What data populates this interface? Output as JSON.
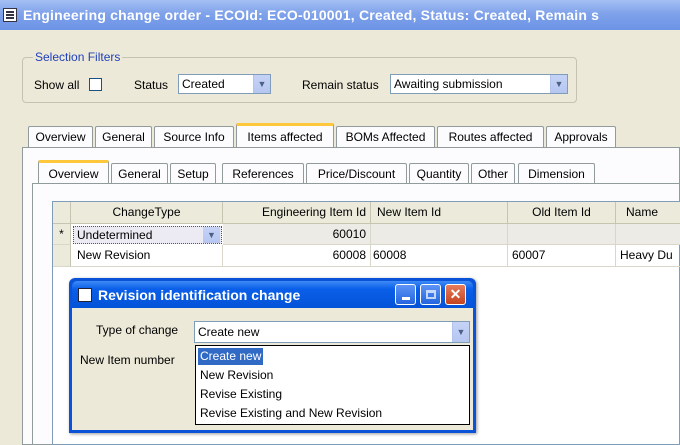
{
  "window": {
    "title": "Engineering change order - ECOId: ECO-010001, Created, Status: Created, Remain s"
  },
  "filters": {
    "legend": "Selection Filters",
    "show_all_label": "Show all",
    "show_all_checked": false,
    "status_label": "Status",
    "status_value": "Created",
    "remain_status_label": "Remain status",
    "remain_status_value": "Awaiting submission"
  },
  "main_tabs": [
    {
      "label": "Overview"
    },
    {
      "label": "General"
    },
    {
      "label": "Source Info"
    },
    {
      "label": "Items affected",
      "active": true
    },
    {
      "label": "BOMs Affected"
    },
    {
      "label": "Routes affected"
    },
    {
      "label": "Approvals"
    }
  ],
  "sub_tabs": [
    {
      "label": "Overview",
      "active": true
    },
    {
      "label": "General"
    },
    {
      "label": "Setup"
    },
    {
      "label": "References"
    },
    {
      "label": "Price/Discount"
    },
    {
      "label": "Quantity"
    },
    {
      "label": "Other"
    },
    {
      "label": "Dimension"
    }
  ],
  "grid": {
    "columns": [
      "ChangeType",
      "Engineering Item Id",
      "New Item Id",
      "Old Item Id",
      "Name"
    ],
    "rows": [
      {
        "marker": "*",
        "change_type": "Undetermined",
        "eng_item_id": "60010",
        "new_item_id": "",
        "old_item_id": "",
        "name": ""
      },
      {
        "marker": "",
        "change_type": "New Revision",
        "eng_item_id": "60008",
        "new_item_id": "60008",
        "old_item_id": "60007",
        "name": "Heavy Du"
      }
    ]
  },
  "dialog": {
    "title": "Revision identification change",
    "type_of_change_label": "Type of change",
    "type_of_change_value": "Create new",
    "new_item_number_label": "New Item number",
    "options": [
      "Create new",
      "New Revision",
      "Revise Existing",
      "Revise Existing and New Revision"
    ],
    "selected_option": "Create new"
  }
}
